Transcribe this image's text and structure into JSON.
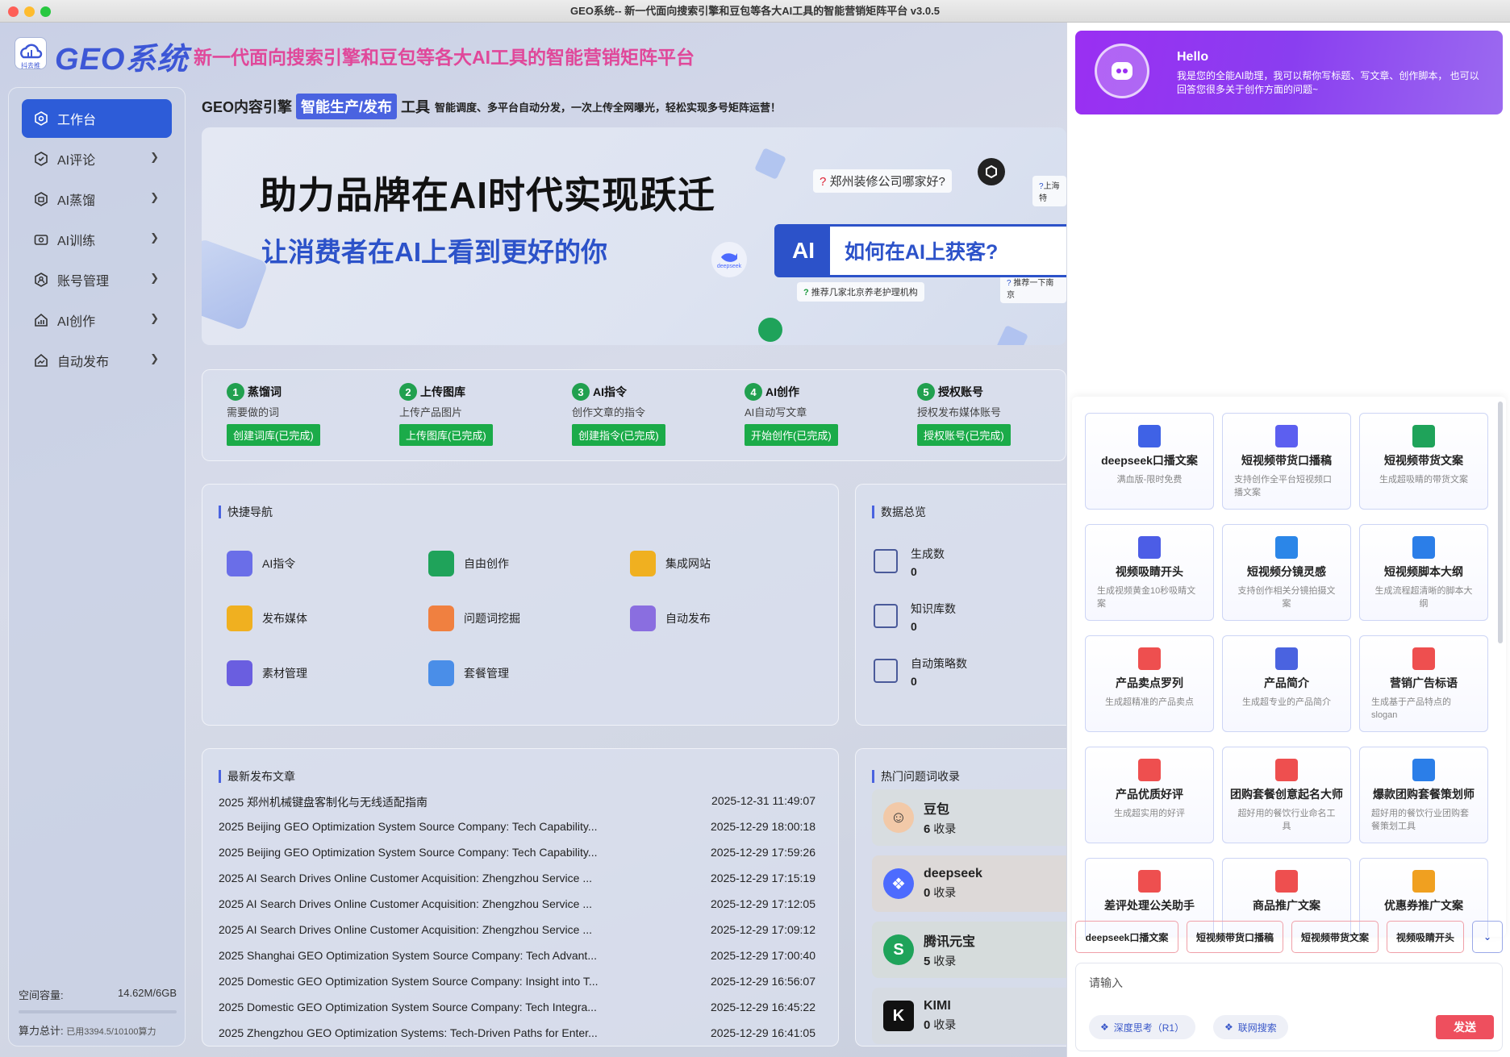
{
  "window": {
    "title": "GEO系统-- 新一代面向搜索引擎和豆包等各大AI工具的智能营销矩阵平台 v3.0.5"
  },
  "brand": {
    "logo_caption": "抖去推",
    "name": "GEO系统",
    "slogan": "新一代面向搜索引擎和豆包等各大AI工具的智能营销矩阵平台"
  },
  "sidebar": {
    "items": [
      {
        "label": "工作台",
        "icon": "hexagon-icon"
      },
      {
        "label": "AI评论",
        "icon": "hexagon-check-icon"
      },
      {
        "label": "AI蒸馏",
        "icon": "distill-icon"
      },
      {
        "label": "AI训练",
        "icon": "training-icon"
      },
      {
        "label": "账号管理",
        "icon": "account-icon"
      },
      {
        "label": "AI创作",
        "icon": "chart-icon"
      },
      {
        "label": "自动发布",
        "icon": "publish-icon"
      }
    ],
    "storage_label": "空间容量:",
    "storage_value": "14.62M/6GB",
    "power_label": "算力总计:",
    "power_value": "已用3394.5/10100算力"
  },
  "header": {
    "prefix": "GEO内容引擎",
    "highlight": "智能生产/发布",
    "suffix": "工具",
    "desc": "智能调度、多平台自动分发，一次上传全网曝光，轻松实现多号矩阵运营！"
  },
  "banner": {
    "title": "助力品牌在AI时代实现跃迁",
    "subtitle": "让消费者在AI上看到更好的你",
    "q1": "郑州装修公司哪家好?",
    "q2": "上海特",
    "q3": "推荐几家北京养老护理机构",
    "q4": "推荐一下南京",
    "search_ai": "AI",
    "search_q": "如何在AI上获客?",
    "ds_label": "deepseek"
  },
  "steps": [
    {
      "num": "1",
      "title": "蒸馏词",
      "desc": "需要做的词",
      "btn": "创建词库(已完成)"
    },
    {
      "num": "2",
      "title": "上传图库",
      "desc": "上传产品图片",
      "btn": "上传图库(已完成)"
    },
    {
      "num": "3",
      "title": "AI指令",
      "desc": "创作文章的指令",
      "btn": "创建指令(已完成)"
    },
    {
      "num": "4",
      "title": "AI创作",
      "desc": "AI自动写文章",
      "btn": "开始创作(已完成)"
    },
    {
      "num": "5",
      "title": "授权账号",
      "desc": "授权发布媒体账号",
      "btn": "授权账号(已完成)"
    }
  ],
  "quick_nav": {
    "title": "快捷导航",
    "items": [
      "AI指令",
      "自由创作",
      "集成网站",
      "发布媒体",
      "问题词挖掘",
      "自动发布",
      "素材管理",
      "套餐管理"
    ]
  },
  "stats": {
    "title": "数据总览",
    "items": [
      {
        "label": "生成数",
        "value": "0"
      },
      {
        "label": "知识库数",
        "value": "0"
      },
      {
        "label": "自动策略数",
        "value": "0"
      }
    ]
  },
  "articles": {
    "title": "最新发布文章",
    "rows": [
      {
        "title": "2025 郑州机械键盘客制化与无线适配指南",
        "time": "2025-12-31 11:49:07"
      },
      {
        "title": "2025 Beijing GEO Optimization System Source Company: Tech Capability...",
        "time": "2025-12-29 18:00:18"
      },
      {
        "title": "2025 Beijing GEO Optimization System Source Company: Tech Capability...",
        "time": "2025-12-29 17:59:26"
      },
      {
        "title": "2025 AI Search Drives Online Customer Acquisition: Zhengzhou Service ...",
        "time": "2025-12-29 17:15:19"
      },
      {
        "title": "2025 AI Search Drives Online Customer Acquisition: Zhengzhou Service ...",
        "time": "2025-12-29 17:12:05"
      },
      {
        "title": "2025 AI Search Drives Online Customer Acquisition: Zhengzhou Service ...",
        "time": "2025-12-29 17:09:12"
      },
      {
        "title": "2025 Shanghai GEO Optimization System Source Company: Tech Advant...",
        "time": "2025-12-29 17:00:40"
      },
      {
        "title": "2025 Domestic GEO Optimization System Source Company: Insight into T...",
        "time": "2025-12-29 16:56:07"
      },
      {
        "title": "2025 Domestic GEO Optimization System Source Company: Tech Integra...",
        "time": "2025-12-29 16:45:22"
      },
      {
        "title": "2025 Zhengzhou GEO Optimization Systems: Tech-Driven Paths for Enter...",
        "time": "2025-12-29 16:41:05"
      }
    ]
  },
  "hot": {
    "title": "热门问题词收录",
    "unit": "收录",
    "items": [
      {
        "name": "豆包",
        "count": "6"
      },
      {
        "name": "deepseek",
        "count": "0"
      },
      {
        "name": "腾讯元宝",
        "count": "5"
      },
      {
        "name": "KIMI",
        "count": "0"
      }
    ]
  },
  "assistant": {
    "hello": "Hello",
    "intro": "我是您的全能AI助理，我可以帮你写标题、写文章、创作脚本， 也可以回答您很多关于创作方面的问题~",
    "cards": [
      {
        "title": "deepseek口播文案",
        "desc": "满血版-限时免费",
        "icon": "deepseek-icon",
        "color": "#3f62e6"
      },
      {
        "title": "短视频带货口播稿",
        "desc": "支持创作全平台短视频口播文案",
        "icon": "shopping-bag-icon",
        "color": "#5c5ff0"
      },
      {
        "title": "短视频带货文案",
        "desc": "生成超吸睛的带货文案",
        "icon": "document-green-icon",
        "color": "#1fa35a"
      },
      {
        "title": "视频吸睛开头",
        "desc": "生成视频黄金10秒吸睛文案",
        "icon": "video-play-icon",
        "color": "#4c5de6"
      },
      {
        "title": "短视频分镜灵感",
        "desc": "支持创作相关分镜拍摄文案",
        "icon": "storyboard-icon",
        "color": "#2b86e8"
      },
      {
        "title": "短视频脚本大纲",
        "desc": "生成流程超清晰的脚本大纲",
        "icon": "video-camera-icon",
        "color": "#2b7ee8"
      },
      {
        "title": "产品卖点罗列",
        "desc": "生成超精准的产品卖点",
        "icon": "hot-tag-icon",
        "color": "#ee4f4f"
      },
      {
        "title": "产品简介",
        "desc": "生成超专业的产品简介",
        "icon": "document-blue-icon",
        "color": "#4a63e0"
      },
      {
        "title": "营销广告标语",
        "desc": "生成基于产品特点的slogan",
        "icon": "star-doc-icon",
        "color": "#ee4f4f"
      },
      {
        "title": "产品优质好评",
        "desc": "生成超实用的好评",
        "icon": "thumbs-up-icon",
        "color": "#ee4f4f"
      },
      {
        "title": "团购套餐创意起名大师",
        "desc": "超好用的餐饮行业命名工具",
        "icon": "gift-bag-icon",
        "color": "#ee4f4f"
      },
      {
        "title": "爆款团购套餐策划师",
        "desc": "超好用的餐饮行业团购套餐策划工具",
        "icon": "edit-doc-icon",
        "color": "#2b7ee8"
      },
      {
        "title": "差评处理公关助手",
        "desc": "",
        "icon": "speech-face-icon",
        "color": "#ee4f4f"
      },
      {
        "title": "商品推广文案",
        "desc": "",
        "icon": "promo-bag-icon",
        "color": "#ee4f4f"
      },
      {
        "title": "优惠券推广文案",
        "desc": "",
        "icon": "coupon-icon",
        "color": "#f0a020"
      }
    ],
    "chips": [
      "deepseek口播文案",
      "短视频带货口播稿",
      "短视频带货文案",
      "视频吸睛开头"
    ],
    "input_placeholder": "请输入",
    "toggle_deep": "深度思考（R1）",
    "toggle_web": "联网搜索",
    "send": "发送"
  },
  "colors": {
    "primary": "#2d5cd8",
    "accent": "#e0489a",
    "success": "#1bab49",
    "send": "#ee4f5e"
  }
}
